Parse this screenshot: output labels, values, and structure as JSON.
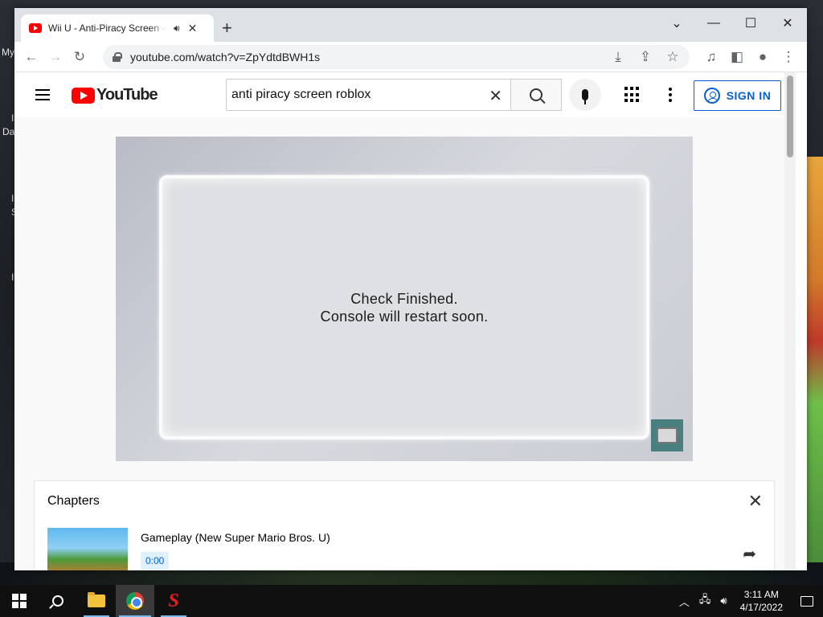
{
  "desktop": {
    "labels": [
      "My",
      "I",
      "Da",
      "I",
      "S",
      "I"
    ]
  },
  "browser": {
    "tab_title": "Wii U - Anti-Piracy Screen - YouTube",
    "new_tab": "+",
    "url": "youtube.com/watch?v=ZpYdtdBWH1s",
    "window_controls": {
      "minimize": "—",
      "restore": "☐",
      "close": "✕",
      "tab_list": "⌄"
    }
  },
  "youtube": {
    "logo_text": "YouTube",
    "search_value": "anti piracy screen roblox",
    "search_placeholder": "Search",
    "signin_label": "SIGN IN",
    "video": {
      "line1": "Check Finished.",
      "line2": "Console will restart soon."
    },
    "chapters": {
      "title": "Chapters",
      "items": [
        {
          "title": "Gameplay (New Super Mario Bros. U)",
          "time": "0:00"
        }
      ]
    }
  },
  "taskbar": {
    "time": "3:11 AM",
    "date": "4/17/2022"
  }
}
